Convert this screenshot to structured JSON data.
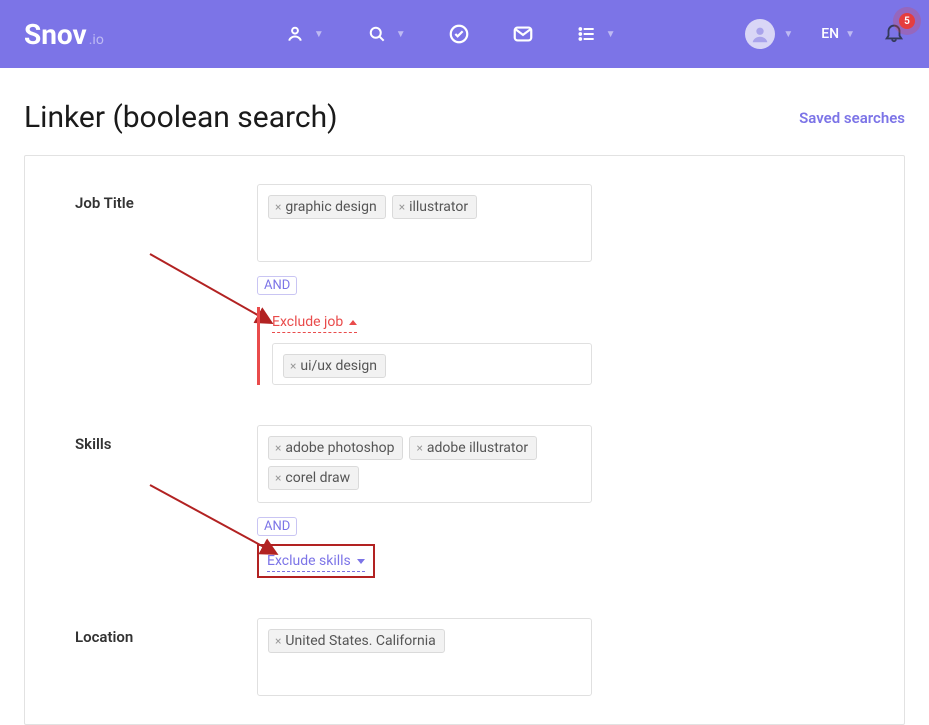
{
  "brand": {
    "name": "Snov",
    "sub": ".io"
  },
  "header": {
    "lang": "EN",
    "notifications": "5"
  },
  "page": {
    "title": "Linker (boolean search)",
    "saved_link": "Saved searches"
  },
  "labels": {
    "job_title": "Job Title",
    "skills": "Skills",
    "location": "Location"
  },
  "badges": {
    "and": "AND"
  },
  "exclude": {
    "job_label": "Exclude job",
    "skills_label": "Exclude skills"
  },
  "tags": {
    "job_title": [
      "graphic design",
      "illustrator"
    ],
    "exclude_job": [
      "ui/ux design"
    ],
    "skills": [
      "adobe photoshop",
      "adobe illustrator",
      "corel draw"
    ],
    "location": [
      "United States. California"
    ]
  }
}
